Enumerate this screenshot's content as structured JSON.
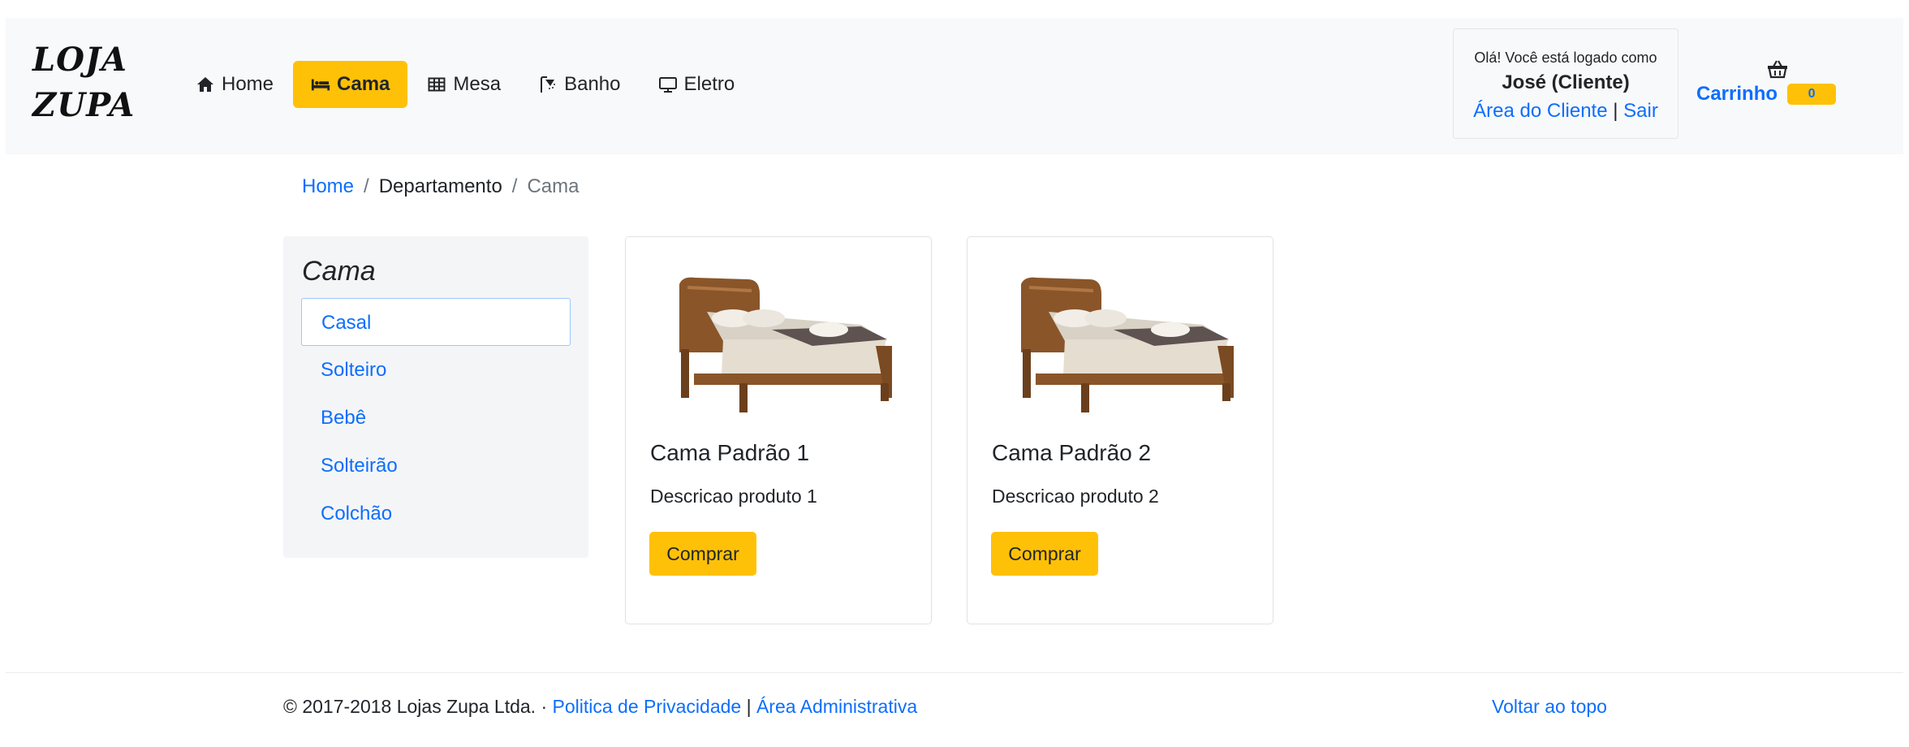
{
  "brand": {
    "line1": "LOJA",
    "line2": "ZUPA"
  },
  "nav": {
    "items": [
      {
        "label": "Home",
        "icon": "home-icon",
        "active": false
      },
      {
        "label": "Cama",
        "icon": "bed-icon",
        "active": true
      },
      {
        "label": "Mesa",
        "icon": "table-icon",
        "active": false
      },
      {
        "label": "Banho",
        "icon": "shower-icon",
        "active": false
      },
      {
        "label": "Eletro",
        "icon": "monitor-icon",
        "active": false
      }
    ]
  },
  "user": {
    "greeting": "Olá! Você está logado como",
    "name": "José (Cliente)",
    "client_area_link": "Área do Cliente",
    "separator": "|",
    "logout_link": "Sair"
  },
  "cart": {
    "label": "Carrinho",
    "icon": "basket-icon",
    "count": "0"
  },
  "breadcrumb": {
    "home": "Home",
    "divider": "/",
    "department": "Departamento",
    "current": "Cama"
  },
  "sidebar": {
    "title": "Cama",
    "categories": [
      {
        "label": "Casal",
        "active": true
      },
      {
        "label": "Solteiro",
        "active": false
      },
      {
        "label": "Bebê",
        "active": false
      },
      {
        "label": "Solteirão",
        "active": false
      },
      {
        "label": "Colchão",
        "active": false
      }
    ]
  },
  "products": [
    {
      "title": "Cama Padrão 1",
      "description": "Descricao produto 1",
      "button": "Comprar",
      "image": "bed-product-image"
    },
    {
      "title": "Cama Padrão 2",
      "description": "Descricao produto 2",
      "button": "Comprar",
      "image": "bed-product-image"
    }
  ],
  "footer": {
    "copyright": "© 2017-2018 Lojas Zupa Ltda. · ",
    "privacy_link": "Politica de Privacidade",
    "separator": " | ",
    "admin_link": "Área Administrativa",
    "back_to_top": "Voltar ao topo"
  },
  "colors": {
    "accent": "#ffc107",
    "link": "#0d6efd",
    "navbar_bg": "#f8f9fa"
  }
}
